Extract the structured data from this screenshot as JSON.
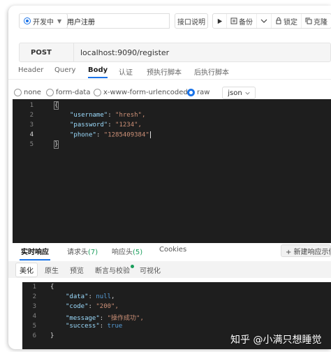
{
  "toolbar": {
    "environment": "开发中",
    "api_name": "用户注册",
    "doc_button": "接口说明",
    "actions": [
      {
        "icon": "play-icon",
        "label": ""
      },
      {
        "icon": "backup-icon",
        "label": "备份"
      },
      {
        "icon": "chevron-down-icon",
        "label": ""
      },
      {
        "icon": "lock-icon",
        "label": "锁定"
      },
      {
        "icon": "clone-icon",
        "label": "克隆"
      }
    ]
  },
  "request": {
    "method": "POST",
    "url": "localhost:9090/register"
  },
  "request_tabs": [
    "Header",
    "Query",
    "Body",
    "认证",
    "预执行脚本",
    "后执行脚本"
  ],
  "active_request_tab": "Body",
  "body_types": [
    "none",
    "form-data",
    "x-www-form-urlencoded",
    "raw"
  ],
  "selected_body_type": "raw",
  "raw_format": "json",
  "request_body_lines": [
    {
      "num": "1",
      "text": "{"
    },
    {
      "num": "2",
      "key": "\"username\"",
      "value": "\"hresh\","
    },
    {
      "num": "3",
      "key": "\"password\"",
      "value": "\"1234\","
    },
    {
      "num": "4",
      "key": "\"phone\"",
      "value": "\"1285409384\""
    },
    {
      "num": "5",
      "text": "}"
    }
  ],
  "response_tabs": [
    {
      "label": "实时响应",
      "count": ""
    },
    {
      "label": "请求头",
      "count": "(7)"
    },
    {
      "label": "响应头",
      "count": "(5)"
    },
    {
      "label": "Cookies",
      "count": ""
    }
  ],
  "new_example_button": "+ 新建响应示例",
  "view_modes": [
    "美化",
    "原生",
    "预览",
    "断言与校验",
    "可视化"
  ],
  "response_lines": [
    {
      "num": "1",
      "text": "{"
    },
    {
      "num": "2",
      "key": "\"data\"",
      "value": "null",
      "literal": true
    },
    {
      "num": "3",
      "key": "\"code\"",
      "value": "\"200\","
    },
    {
      "num": "4",
      "key": "\"message\"",
      "value": "\"操作成功\","
    },
    {
      "num": "5",
      "key": "\"success\"",
      "value": "true",
      "literal": true
    },
    {
      "num": "6",
      "text": "}"
    }
  ],
  "watermark": "知乎 @小满只想睡觉",
  "colors": {
    "accent": "#1a73e8",
    "editor_bg": "#1e1e1e",
    "key": "#9cdcfe",
    "string": "#ce9178",
    "literal": "#569cd6",
    "count": "#1a9e5c"
  }
}
